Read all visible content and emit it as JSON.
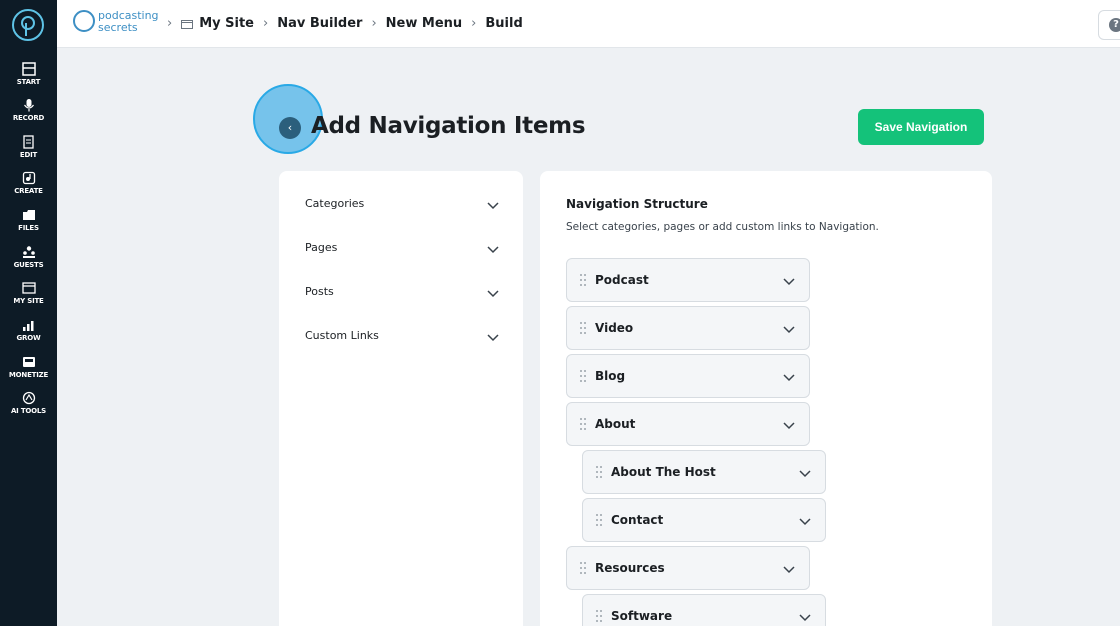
{
  "sidebar": {
    "items": [
      {
        "label": "START",
        "icon": "start-icon"
      },
      {
        "label": "RECORD",
        "icon": "microphone-icon"
      },
      {
        "label": "EDIT",
        "icon": "edit-icon"
      },
      {
        "label": "CREATE",
        "icon": "create-icon"
      },
      {
        "label": "FILES",
        "icon": "files-icon"
      },
      {
        "label": "GUESTS",
        "icon": "guests-icon"
      },
      {
        "label": "MY SITE",
        "icon": "mysite-icon"
      },
      {
        "label": "GROW",
        "icon": "grow-icon"
      },
      {
        "label": "MONETIZE",
        "icon": "monetize-icon"
      },
      {
        "label": "AI TOOLS",
        "icon": "ai-tools-icon"
      }
    ]
  },
  "header": {
    "brand_line1": "podcasting",
    "brand_line2": "secrets",
    "breadcrumbs": [
      "My Site",
      "Nav Builder",
      "New Menu",
      "Build"
    ],
    "help_icon": "help-icon"
  },
  "page": {
    "title": "Add Navigation Items",
    "save_label": "Save Navigation",
    "back_icon": "chevron-left-icon"
  },
  "left_panel": {
    "items": [
      "Categories",
      "Pages",
      "Posts",
      "Custom Links"
    ]
  },
  "structure": {
    "title": "Navigation Structure",
    "description": "Select categories, pages or add custom links to Navigation.",
    "items": [
      {
        "label": "Podcast",
        "level": 0
      },
      {
        "label": "Video",
        "level": 0
      },
      {
        "label": "Blog",
        "level": 0
      },
      {
        "label": "About",
        "level": 0
      },
      {
        "label": "About The Host",
        "level": 1
      },
      {
        "label": "Contact",
        "level": 1
      },
      {
        "label": "Resources",
        "level": 0
      },
      {
        "label": "Software",
        "level": 1
      }
    ]
  },
  "colors": {
    "sidebar_bg": "#0d1b26",
    "accent_green": "#14c27a",
    "brand_blue": "#3d8fc4"
  }
}
